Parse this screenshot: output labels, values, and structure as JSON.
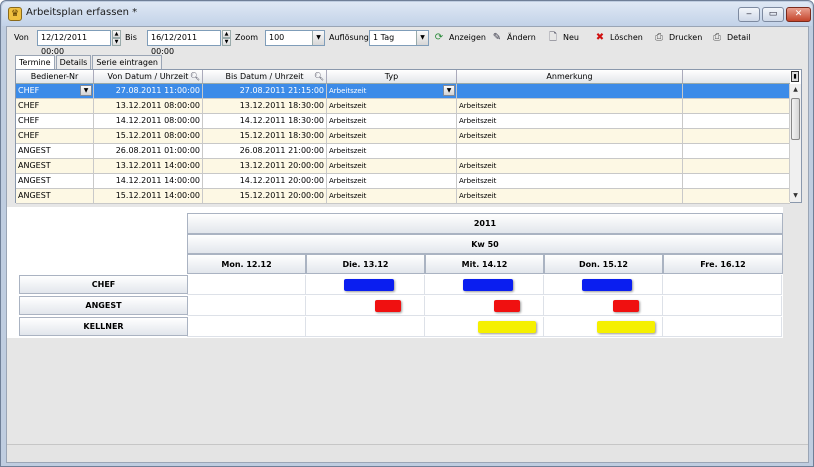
{
  "window": {
    "title": "Arbeitsplan erfassen *",
    "min": "‒",
    "max": "▭",
    "close": "✕"
  },
  "toolbar": {
    "von_label": "Von",
    "von_value": "12/12/2011 00:00",
    "bis_label": "Bis",
    "bis_value": "16/12/2011 00:00",
    "zoom_label": "Zoom",
    "zoom_value": "100",
    "aufloesung_label": "Auflösung",
    "aufloesung_value": "1 Tag",
    "anzeigen": "Anzeigen",
    "aendern": "Ändern",
    "neu": "Neu",
    "loeschen": "Löschen",
    "drucken": "Drucken",
    "detail": "Detail"
  },
  "tabs": [
    "Termine",
    "Details",
    "Serie eintragen"
  ],
  "grid": {
    "columns": [
      "Bediener-Nr",
      "Von Datum / Uhrzeit",
      "Bis Datum / Uhrzeit",
      "Typ",
      "Anmerkung"
    ],
    "rows": [
      [
        "CHEF",
        "27.08.2011 11:00:00",
        "27.08.2011 21:15:00",
        "Arbeitszeit",
        ""
      ],
      [
        "CHEF",
        "13.12.2011 08:00:00",
        "13.12.2011 18:30:00",
        "Arbeitszeit",
        "Arbeitszeit"
      ],
      [
        "CHEF",
        "14.12.2011 08:00:00",
        "14.12.2011 18:30:00",
        "Arbeitszeit",
        "Arbeitszeit"
      ],
      [
        "CHEF",
        "15.12.2011 08:00:00",
        "15.12.2011 18:30:00",
        "Arbeitszeit",
        "Arbeitszeit"
      ],
      [
        "ANGEST",
        "26.08.2011 01:00:00",
        "26.08.2011 21:00:00",
        "Arbeitszeit",
        ""
      ],
      [
        "ANGEST",
        "13.12.2011 14:00:00",
        "13.12.2011 20:00:00",
        "Arbeitszeit",
        "Arbeitszeit"
      ],
      [
        "ANGEST",
        "14.12.2011 14:00:00",
        "14.12.2011 20:00:00",
        "Arbeitszeit",
        "Arbeitszeit"
      ],
      [
        "ANGEST",
        "15.12.2011 14:00:00",
        "15.12.2011 20:00:00",
        "Arbeitszeit",
        "Arbeitszeit"
      ]
    ]
  },
  "schedule": {
    "year": "2011",
    "week": "Kw 50",
    "days": [
      "Mon. 12.12",
      "Die. 13.12",
      "Mit. 14.12",
      "Don. 15.12",
      "Fre. 16.12"
    ],
    "resources": [
      "CHEF",
      "ANGEST",
      "KELLNER"
    ],
    "colors": {
      "CHEF": "#0a1ef0",
      "ANGEST": "#f01010",
      "KELLNER": "#f5f000"
    },
    "bars": [
      {
        "resource": "CHEF",
        "day": 1
      },
      {
        "resource": "CHEF",
        "day": 2
      },
      {
        "resource": "CHEF",
        "day": 3
      },
      {
        "resource": "ANGEST",
        "day": 1
      },
      {
        "resource": "ANGEST",
        "day": 2
      },
      {
        "resource": "ANGEST",
        "day": 3
      },
      {
        "resource": "KELLNER",
        "day": 2
      },
      {
        "resource": "KELLNER",
        "day": 3
      }
    ]
  }
}
